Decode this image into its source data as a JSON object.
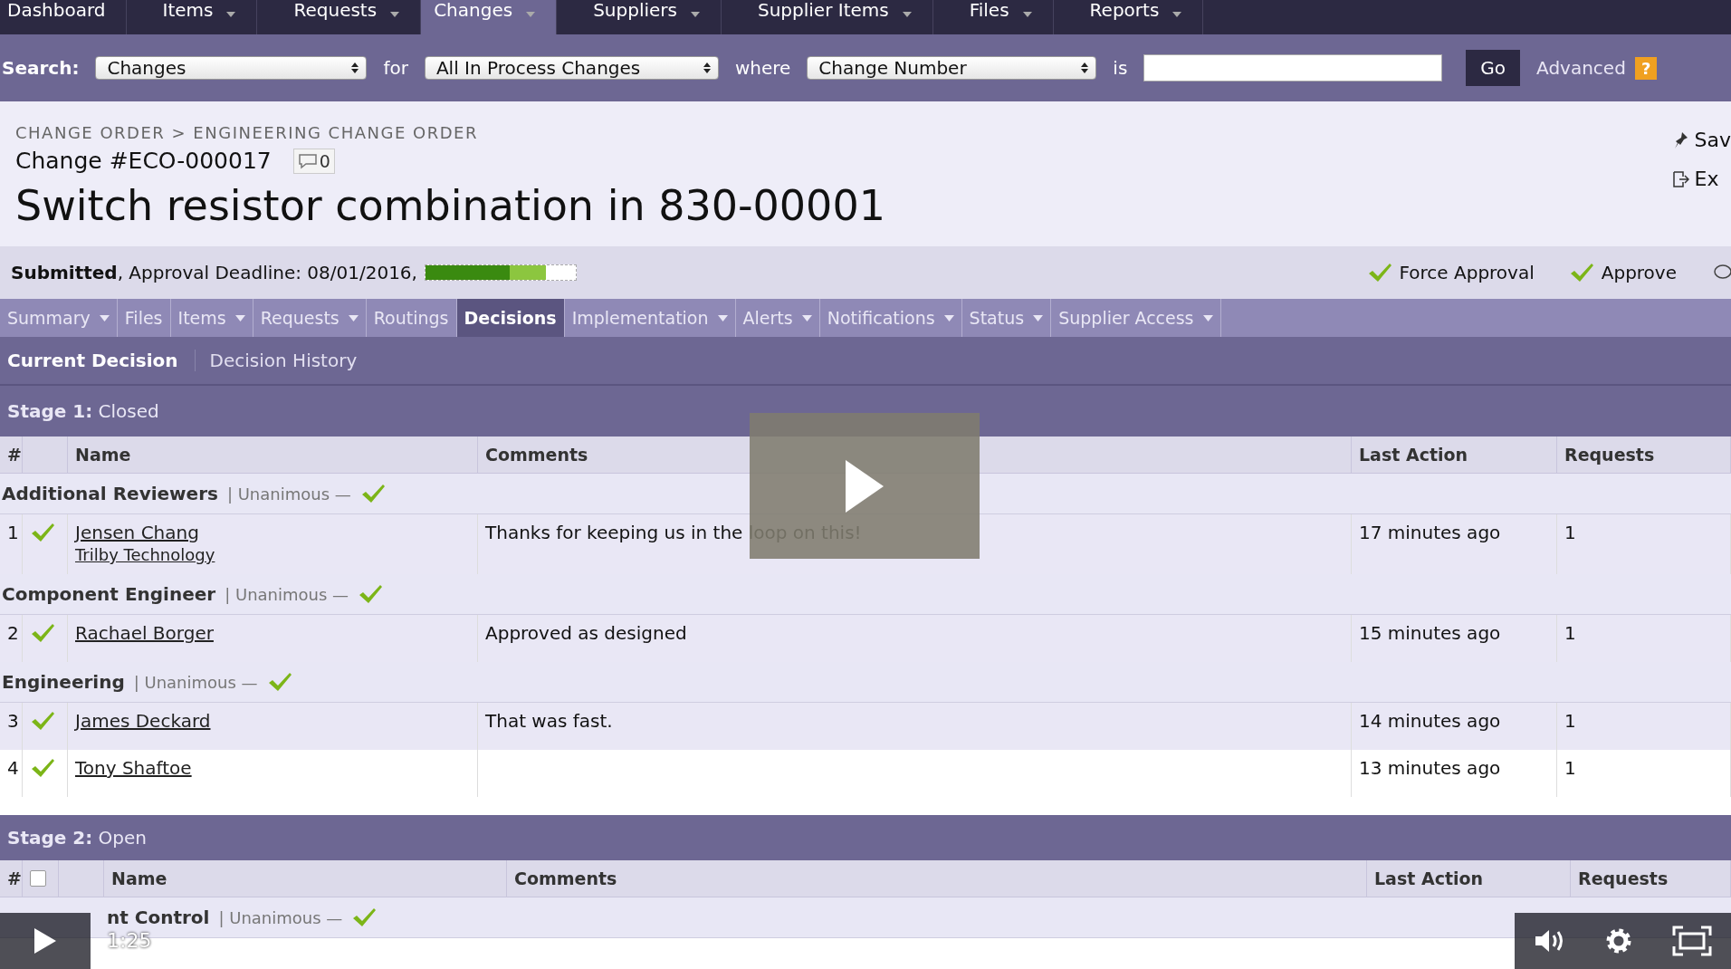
{
  "top_nav": [
    {
      "label": "Dashboard",
      "dropdown": false,
      "selected": false
    },
    {
      "label": "Items",
      "dropdown": true,
      "selected": false
    },
    {
      "label": "Requests",
      "dropdown": true,
      "selected": false
    },
    {
      "label": "Changes",
      "dropdown": true,
      "selected": true
    },
    {
      "label": "Suppliers",
      "dropdown": true,
      "selected": false
    },
    {
      "label": "Supplier Items",
      "dropdown": true,
      "selected": false
    },
    {
      "label": "Files",
      "dropdown": true,
      "selected": false
    },
    {
      "label": "Reports",
      "dropdown": true,
      "selected": false
    }
  ],
  "search": {
    "label": "Search:",
    "scope": "Changes",
    "for_label": "for",
    "filter": "All In Process Changes",
    "where_label": "where",
    "field": "Change Number",
    "is_label": "is",
    "go": "Go",
    "advanced": "Advanced",
    "help": "?"
  },
  "header": {
    "breadcrumb": "CHANGE ORDER > ENGINEERING CHANGE ORDER",
    "number": "Change #ECO-000017",
    "comment_count": "0",
    "title": "Switch resistor combination in 830-00001",
    "actions": [
      "Sav",
      "Ex"
    ]
  },
  "status": {
    "text": "**Submitted**, Approval Deadline: 08/01/2016,",
    "level": 0.8,
    "actions": [
      "Force Approval",
      "Approve"
    ]
  },
  "tabs": [
    {
      "label": "Summary",
      "dropdown": true,
      "selected": false
    },
    {
      "label": "Files",
      "dropdown": false,
      "selected": false
    },
    {
      "label": "Items",
      "dropdown": true,
      "selected": false
    },
    {
      "label": "Requests",
      "dropdown": true,
      "selected": false
    },
    {
      "label": "Routings",
      "dropdown": false,
      "selected": false
    },
    {
      "label": "Decisions",
      "dropdown": false,
      "selected": true
    },
    {
      "label": "Implementation",
      "dropdown": true,
      "selected": false
    },
    {
      "label": "Alerts",
      "dropdown": true,
      "selected": false
    },
    {
      "label": "Notifications",
      "dropdown": true,
      "selected": false
    },
    {
      "label": "Status",
      "dropdown": true,
      "selected": false
    },
    {
      "label": "Supplier Access",
      "dropdown": true,
      "selected": false
    }
  ],
  "subtabs": [
    {
      "label": "Current Decision",
      "selected": true
    },
    {
      "label": "Decision History",
      "selected": false
    }
  ],
  "stages": [
    {
      "label": "**Stage 1:** Closed",
      "kind": "closed",
      "columns": [
        "#",
        "Name",
        "Comments",
        "Last Action",
        "Requests"
      ],
      "groups": [
        {
          "name": "Additional Reviewers",
          "rule": "| Unanimous —",
          "approved": true,
          "rows": [
            {
              "index": "1",
              "approved": true,
              "shaded": true,
              "name": "Jensen Chang",
              "org": "Trilby Technology",
              "comment": "Thanks for keeping us in the loop on this!",
              "last_action": "17 minutes ago",
              "requests": "1"
            }
          ]
        },
        {
          "name": "Component Engineer",
          "rule": "| Unanimous —",
          "approved": true,
          "rows": [
            {
              "index": "2",
              "approved": true,
              "shaded": true,
              "name": "Rachael Borger",
              "comment": "Approved as designed",
              "last_action": "15 minutes ago",
              "requests": "1"
            }
          ]
        },
        {
          "name": "Engineering",
          "rule": "| Unanimous —",
          "approved": true,
          "rows": [
            {
              "index": "3",
              "approved": true,
              "shaded": true,
              "name": "James Deckard",
              "comment": "That was fast.",
              "last_action": "14 minutes ago",
              "requests": "1"
            },
            {
              "index": "4",
              "approved": true,
              "shaded": false,
              "name": "Tony Shaftoe",
              "last_action": "13 minutes ago",
              "requests": "1"
            }
          ]
        }
      ]
    },
    {
      "label": "**Stage 2:** Open",
      "kind": "open",
      "select_all": false,
      "columns": [
        "#",
        "Name",
        "Comments",
        "Last Action",
        "Requests"
      ],
      "groups": [
        {
          "name": "nt Control",
          "rule": "| Unanimous —",
          "approved": true
        }
      ]
    }
  ],
  "player": {
    "time": "1:25"
  }
}
